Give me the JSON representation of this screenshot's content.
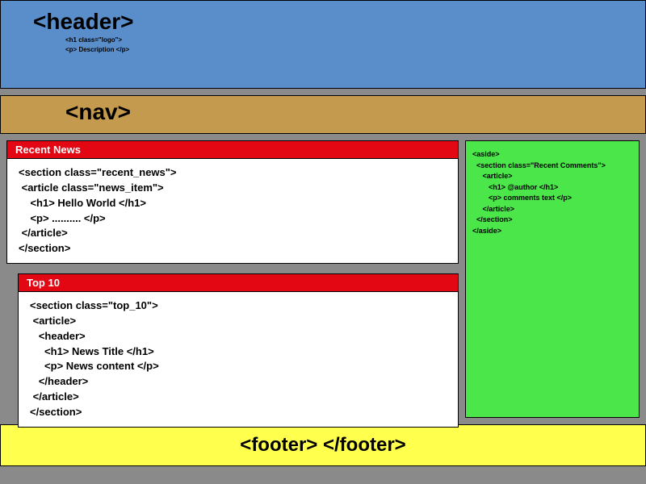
{
  "header": {
    "title": "<header>",
    "sub_line1": "<h1 class=\"logo\">",
    "sub_line2": "<p> Description </p>"
  },
  "nav": {
    "title": "<nav>"
  },
  "recent_news": {
    "header": "Recent News",
    "body": "<section class=\"recent_news\">\n <article class=\"news_item\">\n    <h1> Hello World </h1>\n    <p> .......... </p>\n </article>\n</section>"
  },
  "top10": {
    "header": "Top 10",
    "body": "<section class=\"top_10\">\n <article>\n   <header>\n     <h1> News Title </h1>\n     <p> News content </p>\n   </header>\n </article>\n</section>"
  },
  "aside": {
    "body": "<aside>\n  <section class=\"Recent Comments\">\n     <article>\n        <h1> @author </h1>\n        <p> comments text </p>\n     </article>\n  </section>\n</aside>"
  },
  "footer": {
    "text": "<footer> </footer>"
  }
}
